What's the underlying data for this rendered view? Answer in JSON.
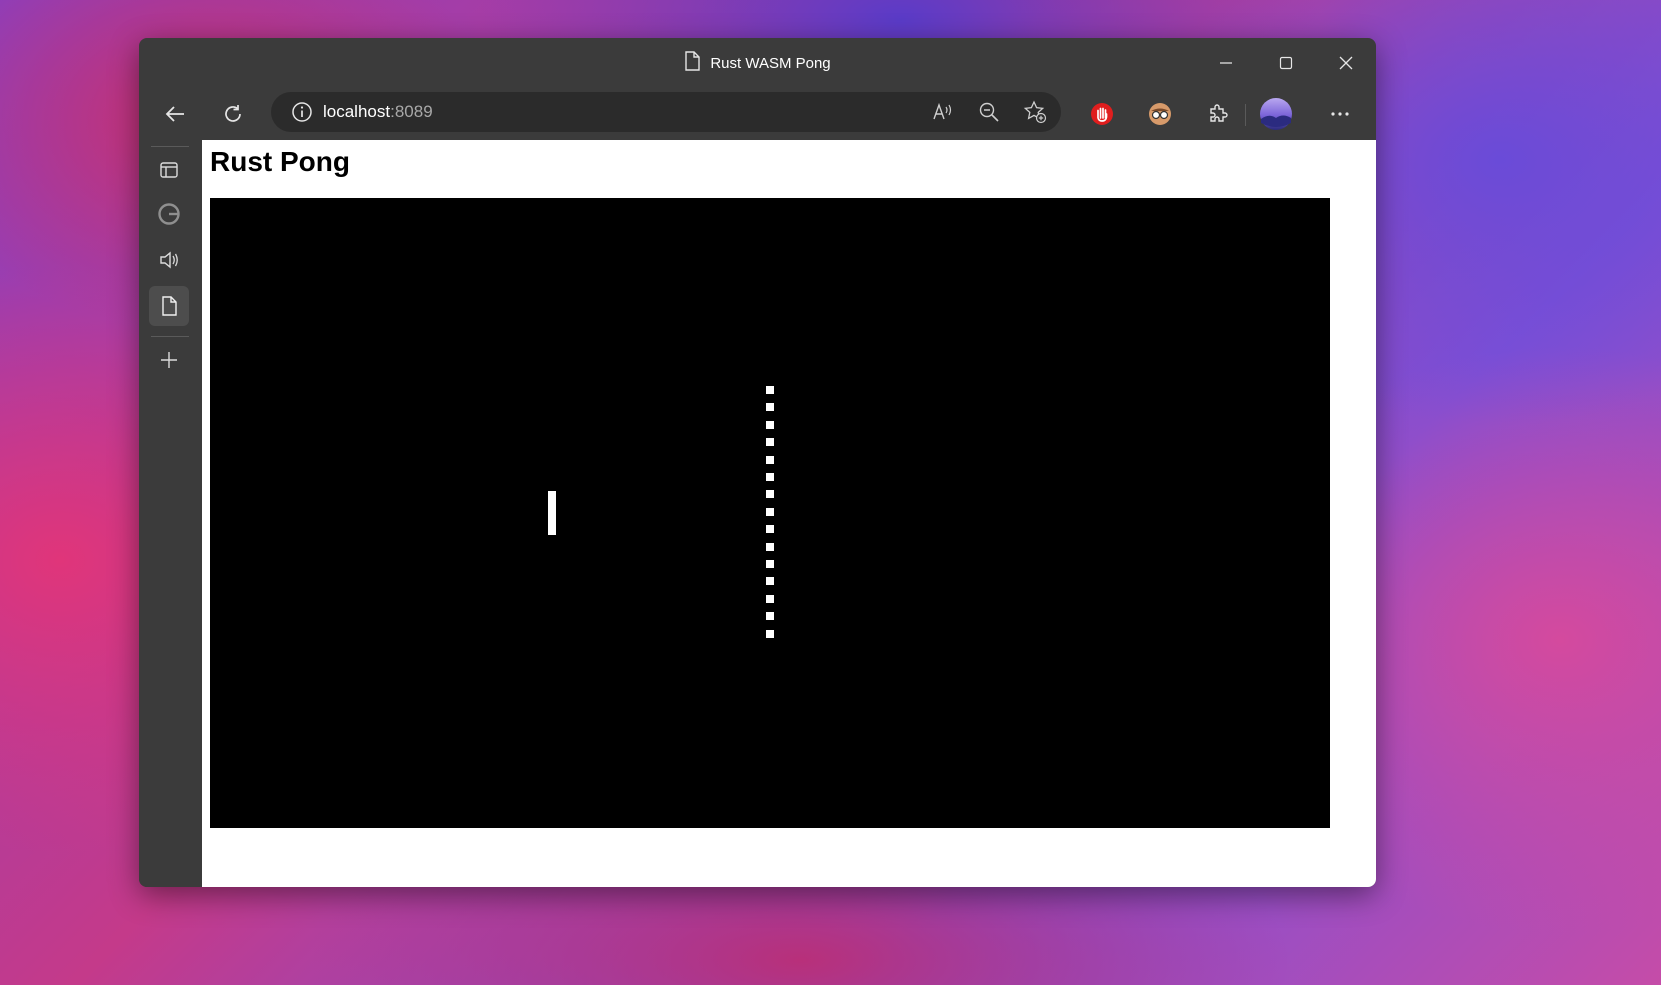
{
  "window": {
    "tab_title": "Rust WASM Pong"
  },
  "address_bar": {
    "host": "localhost",
    "port": ":8089"
  },
  "icons": {
    "page": "document-icon",
    "back": "back-arrow-icon",
    "refresh": "refresh-icon",
    "site_info": "info-icon",
    "read_aloud": "read-aloud-icon",
    "zoom_out": "zoom-out-icon",
    "favorites": "add-favorite-icon",
    "adblock": "adblock-hand-icon",
    "extension_face": "extension-glasses-icon",
    "extensions": "puzzle-icon",
    "profile": "profile-avatar",
    "more": "more-dots-icon",
    "minimize": "minimize-icon",
    "maximize": "maximize-icon",
    "close": "close-icon",
    "sidebar_tabs": "tab-actions-icon",
    "sidebar_google": "google-icon",
    "sidebar_audio": "speaker-icon",
    "sidebar_page": "document-icon",
    "sidebar_add": "plus-icon"
  },
  "page": {
    "heading": "Rust Pong"
  },
  "game": {
    "paddle_count": 1,
    "net_segments": 15
  },
  "colors": {
    "chrome": "#3b3b3b",
    "address_bg": "#2b2b2b",
    "canvas_bg": "#000000",
    "game_fg": "#ffffff",
    "adblock_red": "#e01e1e"
  }
}
